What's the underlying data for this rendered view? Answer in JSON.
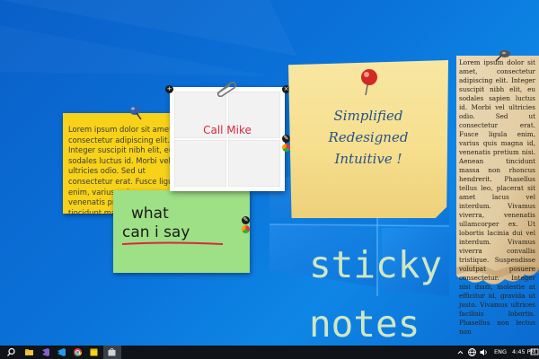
{
  "desktop": {
    "title_line1": "sticky",
    "title_line2": "notes"
  },
  "notes": {
    "yellow": {
      "text": "Lorem ipsum dolor sit amet, consectetur adipiscing elit. Integer suscipit nibh elit, eu sodales luctus id. Morbi vel ultricies odio. Sed ut consectetur erat. Fusce ligula enim, varius quis magna venenatis pretium nisi. Aenean tincidunt massa non rhoncus"
    },
    "green": {
      "handwriting_line1": "what",
      "handwriting_line2": "can i say"
    },
    "white": {
      "text": "Call Mike"
    },
    "paper": {
      "line1": "Simplified",
      "line2": "Redesigned",
      "line3": "Intuitive !"
    },
    "parchment": {
      "text": "Lorem ipsum dolor sit amet, consectetur adipiscing elit. Integer suscipit nibh elit, eu sodales sapien luctus id. Morbi vel ultricies odio. Sed ut consectetur erat. Fusce ligula enim, varius quis magna id, venenatis pretium nisi. Aenean tincidunt massa non rhoncus hendrerit. Phasellus tellus leo, placerat sit amet lacus vel interdum. Vivamus viverra, venenatis ullamcorper ex. Ut lobortis lacinia dui vel interdum. Vivamus viverra convallis tristique. Suspendisse volutpat posuere consectetur. Integer nisi diam, molestie at efficitur id, gravida ut justo. Vivamus ultrices facilisis lobortis. Phasellus non lectus non"
    }
  },
  "taskbar": {
    "icons": [
      "search-icon",
      "file-explorer-icon",
      "visual-studio-icon",
      "vs-code-icon",
      "chrome-icon",
      "sticky-notes-app-icon",
      "store-icon"
    ],
    "language": "ENG",
    "time": "4:45 PM"
  },
  "colors": {
    "desktop_blue": "#0a73da",
    "yellow_note": "#f7d218",
    "green_note": "#9ee086",
    "call_red": "#d8283c",
    "paper_ink": "#27528a",
    "title_green": "#cfe6c3"
  }
}
